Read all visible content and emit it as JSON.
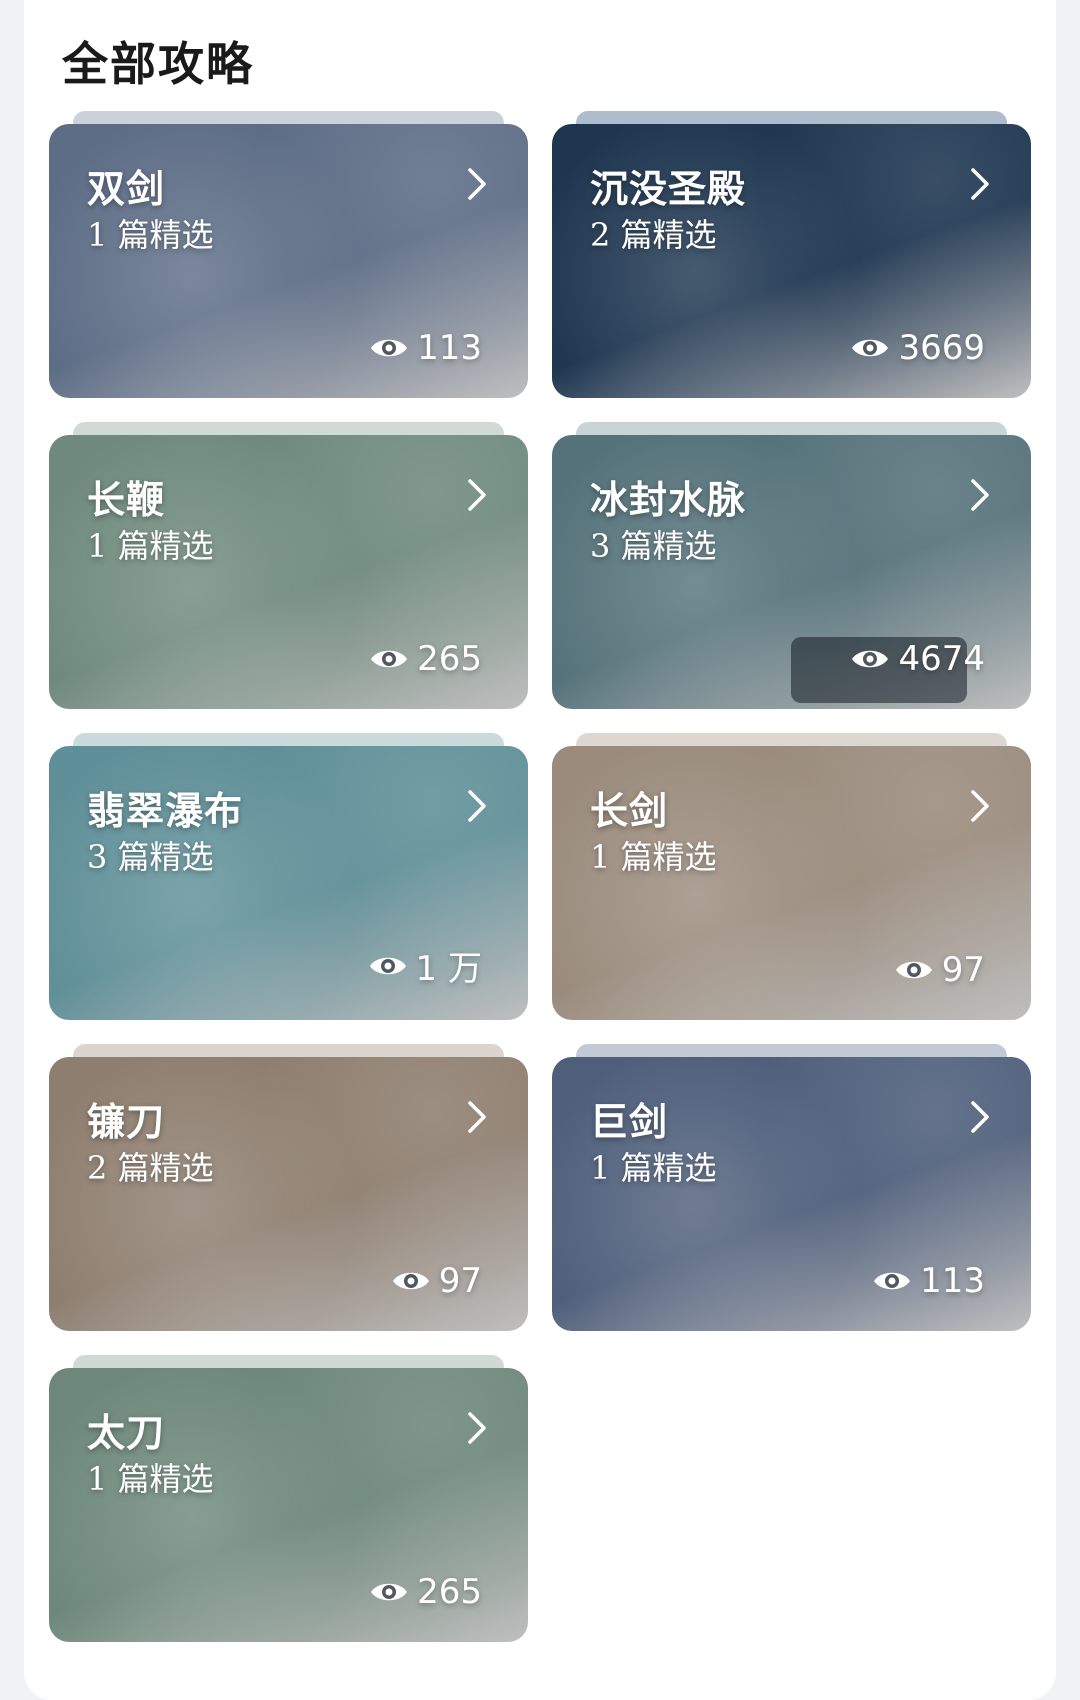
{
  "section": {
    "title": "全部攻略"
  },
  "cards": [
    {
      "name": "双剑",
      "count": "1 篇精选",
      "views": "113",
      "theme": "#5d6d86",
      "tab": "#b9c2cf"
    },
    {
      "name": "沉没圣殿",
      "count": "2 篇精选",
      "views": "3669",
      "theme": "#1e3650",
      "tab": "#93a6ba"
    },
    {
      "name": "长鞭",
      "count": "1 篇精选",
      "views": "265",
      "theme": "#6f8a7d",
      "tab": "#c2cec6"
    },
    {
      "name": "冰封水脉",
      "count": "3 篇精选",
      "views": "4674",
      "theme": "#55727a",
      "tab": "#b7c6c8"
    },
    {
      "name": "翡翠瀑布",
      "count": "3 篇精选",
      "views": "1 万",
      "theme": "#5f8f98",
      "tab": "#b8cdd1"
    },
    {
      "name": "长剑",
      "count": "1 篇精选",
      "views": "97",
      "theme": "#9a8b7c",
      "tab": "#d3cac2"
    },
    {
      "name": "镰刀",
      "count": "2 篇精选",
      "views": "97",
      "theme": "#8e7e6f",
      "tab": "#d0c6bd"
    },
    {
      "name": "巨剑",
      "count": "1 篇精选",
      "views": "113",
      "theme": "#4f5f7b",
      "tab": "#aeb8c8"
    },
    {
      "name": "太刀",
      "count": "1 篇精选",
      "views": "265",
      "theme": "#6d887a",
      "tab": "#c0cdc4"
    }
  ]
}
